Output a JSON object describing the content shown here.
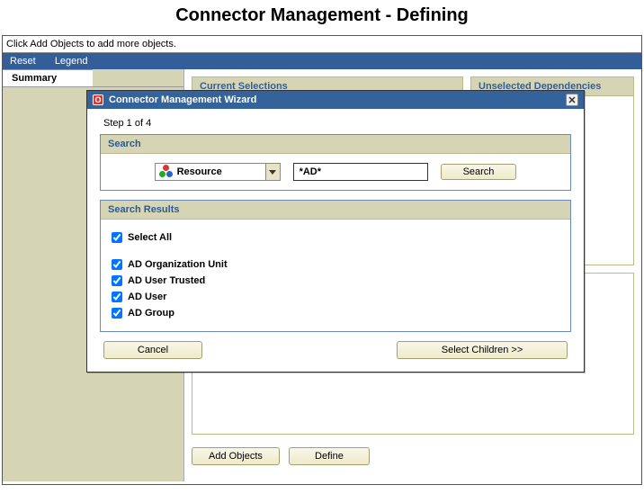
{
  "page_title": "Connector Management - Defining",
  "hint": "Click Add Objects to add more objects.",
  "nav": {
    "reset": "Reset",
    "legend": "Legend"
  },
  "sidebar": {
    "tab": "Summary"
  },
  "panels": {
    "current_selections": "Current Selections",
    "unselected_dependencies": "Unselected Dependencies"
  },
  "buttons": {
    "add_objects": "Add Objects",
    "define": "Define"
  },
  "modal": {
    "title": "Connector Management Wizard",
    "step": "Step 1 of 4",
    "search_header": "Search",
    "combo_value": "Resource",
    "search_value": "*AD*",
    "search_button": "Search",
    "results_header": "Search Results",
    "select_all": "Select All",
    "results": [
      "AD Organization Unit",
      "AD User Trusted",
      "AD User",
      "AD Group"
    ],
    "cancel": "Cancel",
    "select_children": "Select Children >>"
  }
}
